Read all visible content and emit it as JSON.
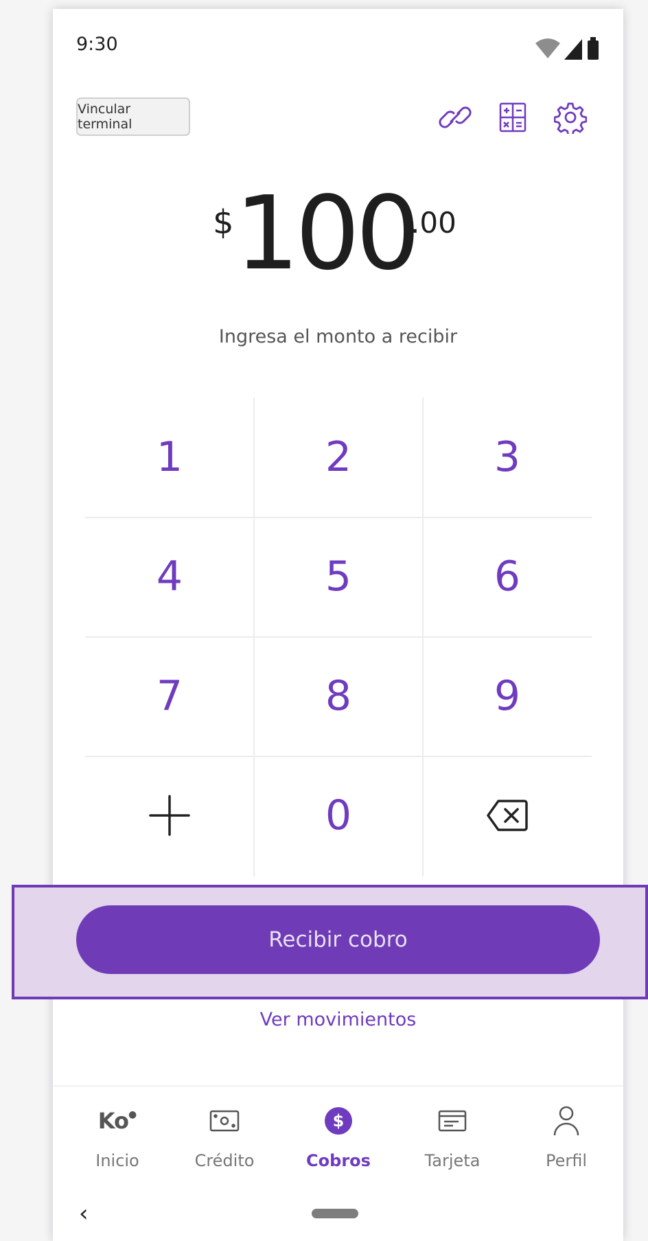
{
  "status": {
    "time": "9:30"
  },
  "header": {
    "vincular_label": "Vincular terminal"
  },
  "amount": {
    "currency": "$",
    "integer": "100",
    "decimals": ".00",
    "hint": "Ingresa el monto a recibir"
  },
  "keypad": {
    "keys": [
      "1",
      "2",
      "3",
      "4",
      "5",
      "6",
      "7",
      "8",
      "9",
      "+",
      "0",
      "⌫"
    ]
  },
  "cta": {
    "label": "Recibir cobro"
  },
  "link": {
    "label": "Ver movimientos"
  },
  "nav": {
    "items": [
      {
        "label": "Inicio",
        "icon": "ko-logo-icon"
      },
      {
        "label": "Crédito",
        "icon": "cash-icon"
      },
      {
        "label": "Cobros",
        "icon": "dollar-icon",
        "active": true
      },
      {
        "label": "Tarjeta",
        "icon": "card-icon"
      },
      {
        "label": "Perfil",
        "icon": "user-icon"
      }
    ],
    "logo_text": "Ko",
    "dollar_sign": "$"
  },
  "system": {
    "back": "‹"
  },
  "colors": {
    "accent": "#6f3bbf",
    "cta": "#6f3bb7",
    "highlight": "#e2d5ec"
  }
}
